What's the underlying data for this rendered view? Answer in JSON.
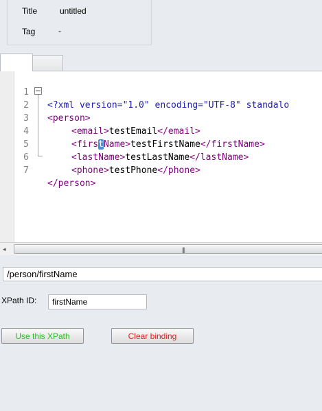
{
  "properties": {
    "title_label": "Title",
    "title_value": "untitled",
    "tag_label": "Tag",
    "tag_value": "-"
  },
  "tabs": [
    {
      "label": ""
    },
    {
      "label": ""
    }
  ],
  "editor": {
    "line_numbers": [
      "1",
      "2",
      "3",
      "4",
      "5",
      "6",
      "7"
    ],
    "lines": {
      "l1": "<?xml version=\"1.0\" encoding=\"UTF-8\" standalo",
      "l2": "<person>",
      "l3_open": "<email>",
      "l3_text": "testEmail",
      "l3_close": "</email>",
      "l4_open_a": "<firs",
      "l4_open_caret": "t",
      "l4_open_b": "Name>",
      "l4_text": "testFirstName",
      "l4_close": "</firstName>",
      "l5_open": "<lastName>",
      "l5_text": "testLastName",
      "l5_close": "</lastName>",
      "l6_open": "<phone>",
      "l6_text": "testPhone",
      "l6_close": "</phone>",
      "l7": "</person>"
    }
  },
  "scrollbar": {
    "left_arrow": "◂",
    "grip": "|||"
  },
  "xpath": {
    "value": "/person/firstName"
  },
  "xpath_id": {
    "label": "XPath ID:",
    "value": "firstName"
  },
  "buttons": {
    "use_label": "Use this XPath",
    "clear_label": "Clear binding"
  },
  "colors": {
    "tag": "#7f007f",
    "declaration": "#2020b0",
    "use_button_text": "#2eb82e",
    "clear_button_text": "#e02020",
    "caret_highlight": "#4a8fd8"
  }
}
